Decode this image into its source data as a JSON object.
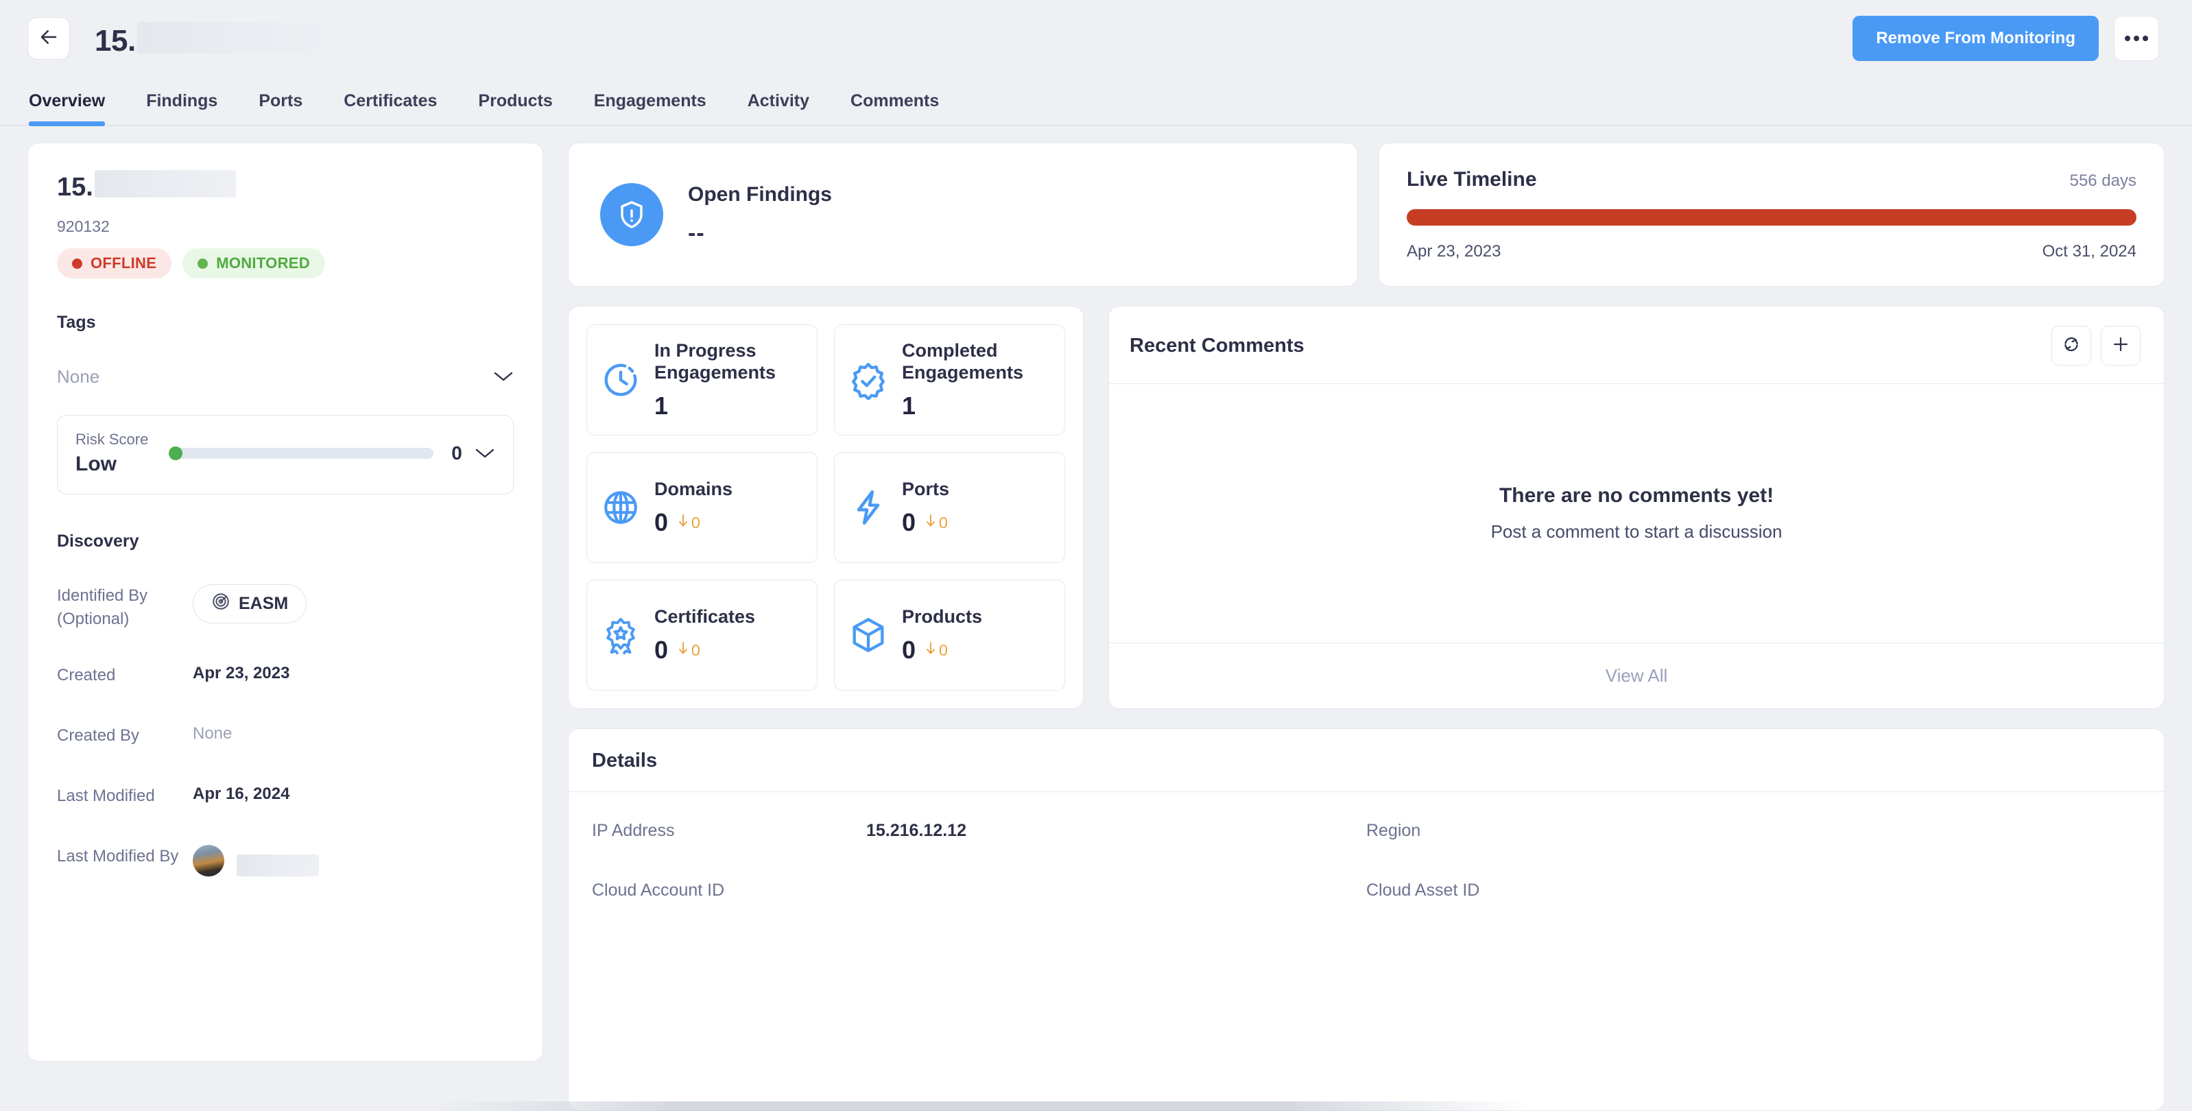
{
  "header": {
    "back_icon": "arrow-left-icon",
    "title_prefix": "15.",
    "title_redacted": true,
    "remove_button": "Remove From Monitoring",
    "more_icon": "ellipsis-icon"
  },
  "tabs": [
    {
      "label": "Overview",
      "active": true
    },
    {
      "label": "Findings",
      "active": false
    },
    {
      "label": "Ports",
      "active": false
    },
    {
      "label": "Certificates",
      "active": false
    },
    {
      "label": "Products",
      "active": false
    },
    {
      "label": "Engagements",
      "active": false
    },
    {
      "label": "Activity",
      "active": false
    },
    {
      "label": "Comments",
      "active": false
    }
  ],
  "asset": {
    "name_prefix": "15.",
    "id": "920132",
    "status_badges": [
      {
        "label": "OFFLINE",
        "color": "#cf3a28",
        "bg": "#fbe8e6"
      },
      {
        "label": "MONITORED",
        "color": "#4fab3e",
        "bg": "#e9f7e7"
      }
    ],
    "tags_label": "Tags",
    "tags_value": "None",
    "tags_chevron_icon": "chevron-down-icon",
    "risk": {
      "caption": "Risk Score",
      "level": "Low",
      "score": "0",
      "slider_percent": 0,
      "thumb_color": "#4caf50",
      "chevron_icon": "chevron-down-icon"
    },
    "discovery_label": "Discovery",
    "meta": [
      {
        "key": "Identified By (Optional)",
        "type": "chip",
        "value": "EASM",
        "icon": "radar-target-icon"
      },
      {
        "key": "Created",
        "type": "text",
        "value": "Apr 23, 2023"
      },
      {
        "key": "Created By",
        "type": "muted",
        "value": "None"
      },
      {
        "key": "Last Modified",
        "type": "text",
        "value": "Apr 16, 2024"
      },
      {
        "key": "Last Modified By",
        "type": "avatar",
        "value": ""
      }
    ]
  },
  "open_findings": {
    "icon": "shield-alert-icon",
    "icon_bg": "#4a9af5",
    "title": "Open Findings",
    "value": "--"
  },
  "live_timeline": {
    "title": "Live Timeline",
    "duration": "556 days",
    "bar_color": "#c73d24",
    "bar_percent": 100,
    "start_date": "Apr 23, 2023",
    "end_date": "Oct 31, 2024"
  },
  "stats": [
    {
      "label": "In Progress Engagements",
      "value": "1",
      "delta": null,
      "icon": "clock-dashed-icon"
    },
    {
      "label": "Completed Engagements",
      "value": "1",
      "delta": null,
      "icon": "badge-check-icon"
    },
    {
      "label": "Domains",
      "value": "0",
      "delta": "0",
      "delta_icon": "arrow-down-icon",
      "icon": "globe-icon"
    },
    {
      "label": "Ports",
      "value": "0",
      "delta": "0",
      "delta_icon": "arrow-down-icon",
      "icon": "bolt-icon"
    },
    {
      "label": "Certificates",
      "value": "0",
      "delta": "0",
      "delta_icon": "arrow-down-icon",
      "icon": "award-ribbon-icon"
    },
    {
      "label": "Products",
      "value": "0",
      "delta": "0",
      "delta_icon": "arrow-down-icon",
      "icon": "cube-icon"
    }
  ],
  "recent_comments": {
    "title": "Recent Comments",
    "refresh_icon": "refresh-icon",
    "add_icon": "plus-icon",
    "empty_title": "There are no comments yet!",
    "empty_subtitle": "Post a comment to start a discussion",
    "view_all": "View All"
  },
  "details": {
    "title": "Details",
    "fields": [
      {
        "key": "IP Address",
        "value": "15.216.12.12"
      },
      {
        "key": "Region",
        "value": ""
      },
      {
        "key": "Cloud Account ID",
        "value": ""
      },
      {
        "key": "Cloud Asset ID",
        "value": ""
      }
    ]
  },
  "colors": {
    "accent": "#4a9af5",
    "page_bg": "#eef0f4",
    "card_bg": "#ffffff",
    "text": "#2d3047",
    "muted": "#6d7290",
    "danger": "#cf3a28",
    "timeline": "#c73d24",
    "success": "#4fab3e",
    "delta": "#e8a33d"
  }
}
